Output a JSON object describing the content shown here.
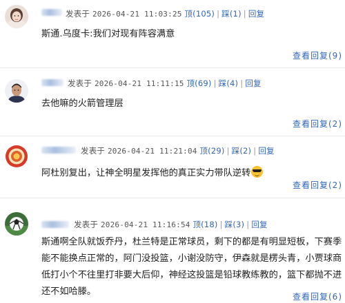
{
  "comments": [
    {
      "meta": {
        "posted_prefix": "发表于",
        "time": "2026-04-21 11:03:25",
        "up": "顶(105)",
        "down": "踩(1)",
        "reply": "回复"
      },
      "text": "斯通.乌度卡:我们对现有阵容满意",
      "view_replies": "查看回复(9)"
    },
    {
      "meta": {
        "posted_prefix": "发表于",
        "time": "2026-04-21 11:11:15",
        "up": "顶(69)",
        "down": "踩(4)",
        "reply": "回复"
      },
      "text": "去他嘛的火箭管理层",
      "view_replies": "查看回复(2)"
    },
    {
      "meta": {
        "posted_prefix": "发表于",
        "time": "2026-04-21 11:21:04",
        "up": "顶(29)",
        "down": "踩(2)",
        "reply": "回复"
      },
      "text": "阿杜别复出，让神全明星发挥他的真正实力带队逆转",
      "view_replies": "查看回复(2)"
    },
    {
      "meta": {
        "posted_prefix": "发表于",
        "time": "2026-04-21 11:16:54",
        "up": "顶(18)",
        "down": "踩(3)",
        "reply": "回复"
      },
      "text": "斯通啊全队就饭乔丹，杜兰特是正常球员，剩下的都是有明显短板，下赛季能不能换点正常的，阿门没投篮，小谢没防守，伊森就是楞头青，小贾球商低打小个不往里打非要大后仰，神经这投篮是铅球教练教的，篮下都抛不进还不如哈滕。",
      "view_replies": "查看回复(6)"
    }
  ],
  "icons": {
    "emoji": "sunglasses-emoji"
  },
  "colors": {
    "link": "#3366bb",
    "meta": "#555555",
    "text": "#222222",
    "divider": "#e6e6e6"
  }
}
